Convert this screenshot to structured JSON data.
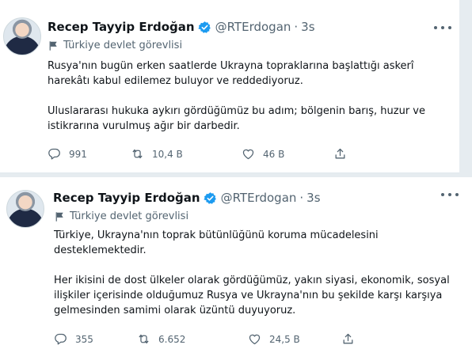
{
  "tweets": [
    {
      "name": "Recep Tayyip Erdoğan",
      "handle": "@RTErdogan",
      "dot": "·",
      "time": "3s",
      "label": "Türkiye devlet görevlisi",
      "text": "Rusya'nın bugün erken saatlerde Ukrayna topraklarına başlattığı askerî harekâtı kabul edilemez buluyor ve reddediyoruz.\n\nUluslararası hukuka aykırı gördüğümüz bu adım; bölgenin barış, huzur ve istikrarına vurulmuş ağır bir darbedir.",
      "replies": "991",
      "retweets": "10,4 B",
      "likes": "46 B"
    },
    {
      "name": "Recep Tayyip Erdoğan",
      "handle": "@RTErdogan",
      "dot": "·",
      "time": "3s",
      "label": "Türkiye devlet görevlisi",
      "text": "Türkiye, Ukrayna'nın toprak bütünlüğünü koruma mücadelesini desteklemektedir.\n\nHer ikisini de dost ülkeler olarak gördüğümüz, yakın siyasi, ekonomik, sosyal ilişkiler içerisinde olduğumuz Rusya ve Ukrayna'nın bu şekilde karşı karşıya gelmesinden samimi olarak üzüntü duyuyoruz.",
      "replies": "355",
      "retweets": "6.652",
      "likes": "24,5 B"
    }
  ],
  "colors": {
    "accent": "#1d9bf0",
    "muted": "#536471",
    "text": "#0f1419",
    "background": "#e6ecf0"
  },
  "icons": [
    "verified-badge-icon",
    "flag-icon",
    "reply-icon",
    "retweet-icon",
    "like-icon",
    "share-icon",
    "more-icon"
  ]
}
